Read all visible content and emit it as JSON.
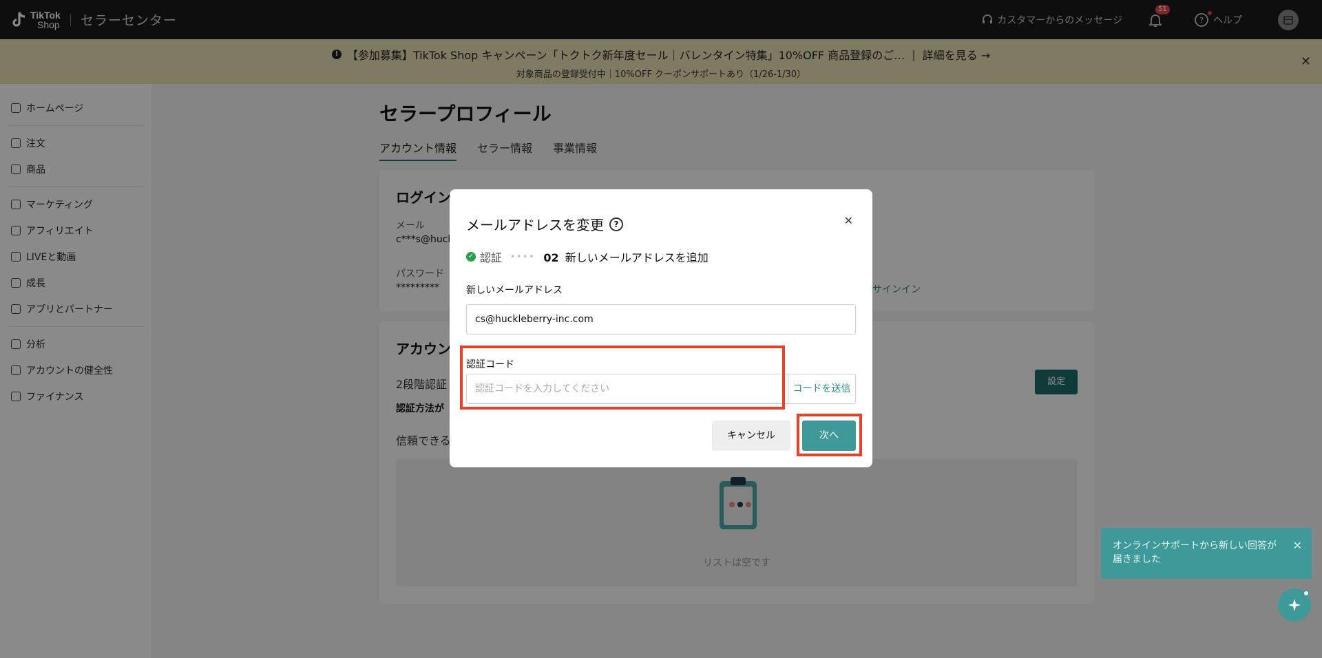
{
  "topbar": {
    "logo_line1": "TikTok",
    "logo_line2": "Shop",
    "title": "セラーセンター",
    "messages": "カスタマーからのメッセージ",
    "notifications_count": "51",
    "help": "ヘルプ"
  },
  "banner": {
    "headline": "【参加募集】TikTok Shop キャンペーン「トクトク新年度セール｜バレンタイン特集」10%OFF 商品登録のご…",
    "detail_link": "詳細を見る →",
    "subline": "対象商品の登録受付中｜10%OFF クーポンサポートあり（1/26-1/30）"
  },
  "sidebar": {
    "items": [
      {
        "label": "ホームページ"
      },
      {
        "label": "注文"
      },
      {
        "label": "商品"
      },
      {
        "label": "マーケティング"
      },
      {
        "label": "アフィリエイト"
      },
      {
        "label": "LIVEと動画"
      },
      {
        "label": "成長"
      },
      {
        "label": "アプリとパートナー"
      },
      {
        "label": "分析"
      },
      {
        "label": "アカウントの健全性"
      },
      {
        "label": "ファイナンス"
      }
    ]
  },
  "page": {
    "title": "セラープロフィール",
    "tabs": [
      "アカウント情報",
      "セラー情報",
      "事業情報"
    ],
    "login_title": "ログイン",
    "email_label": "メール",
    "email_value": "c***s@huck",
    "password_label": "パスワード",
    "password_value": "*********",
    "signin_link": "サインイン",
    "account_title": "アカウン",
    "two_factor": "2段階認証",
    "auth_method": "認証方法が",
    "trusted": "信頼できる",
    "set_button": "設定",
    "empty_text": "リストは空です"
  },
  "modal": {
    "title": "メールアドレスを変更",
    "step1": "認証",
    "step2_num": "02",
    "step2": "新しいメールアドレスを追加",
    "new_email_label": "新しいメールアドレス",
    "new_email_value": "cs@huckleberry-inc.com",
    "code_label": "認証コード",
    "code_placeholder": "認証コードを入力してください",
    "send_code": "コードを送信",
    "cancel": "キャンセル",
    "next": "次へ"
  },
  "toast": {
    "text": "オンラインサポートから新しい回答が届きました"
  }
}
